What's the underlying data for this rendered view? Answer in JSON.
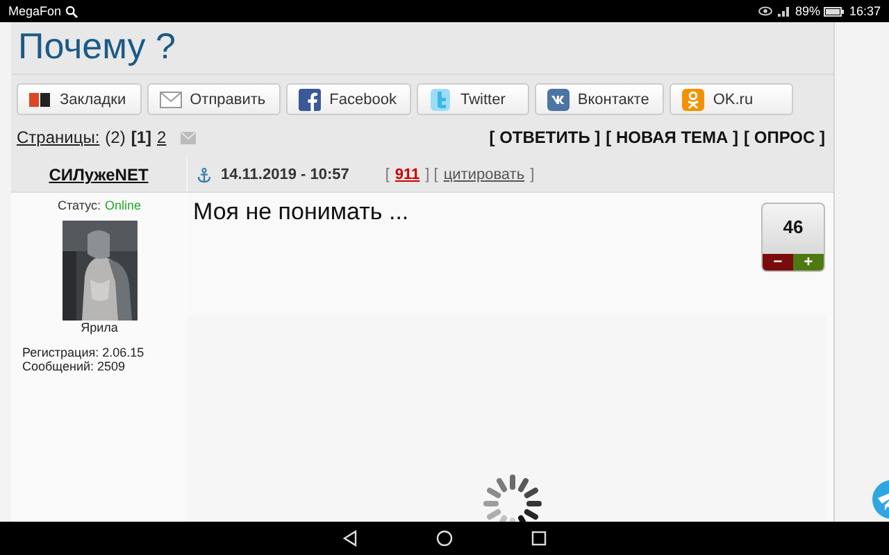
{
  "status_bar": {
    "carrier": "MegaFon",
    "battery": "89%",
    "time": "16:37"
  },
  "topic": {
    "title": "Почему ?"
  },
  "share_buttons": [
    {
      "kind": "yandex",
      "label": "Закладки"
    },
    {
      "kind": "mail",
      "label": "Отправить"
    },
    {
      "kind": "facebook",
      "label": "Facebook"
    },
    {
      "kind": "twitter",
      "label": "Twitter"
    },
    {
      "kind": "vk",
      "label": "Вконтакте"
    },
    {
      "kind": "ok",
      "label": "OK.ru"
    }
  ],
  "pagination": {
    "label": "Страницы:",
    "count": "(2)",
    "pages": [
      {
        "label": "[1]",
        "selected": true
      },
      {
        "label": "2",
        "selected": false
      }
    ]
  },
  "actions": [
    "[ ОТВЕТИТЬ ]",
    "[ НОВАЯ ТЕМА ]",
    "[ ОПРОС ]"
  ],
  "post": {
    "author": "СИЛужеNET",
    "status_label": "Статус:",
    "status": "Online",
    "rank": "Ярила",
    "registration": "Регистрация: 2.06.15",
    "messages": "Сообщений: 2509",
    "date": "14.11.2019 - 10:57",
    "open_bracket": "[",
    "number": "911",
    "middle_brackets": "] [",
    "quote": "цитировать",
    "close_bracket": "]",
    "text": "Моя не понимать ...",
    "rating": "46",
    "minus": "−",
    "plus": "+"
  }
}
